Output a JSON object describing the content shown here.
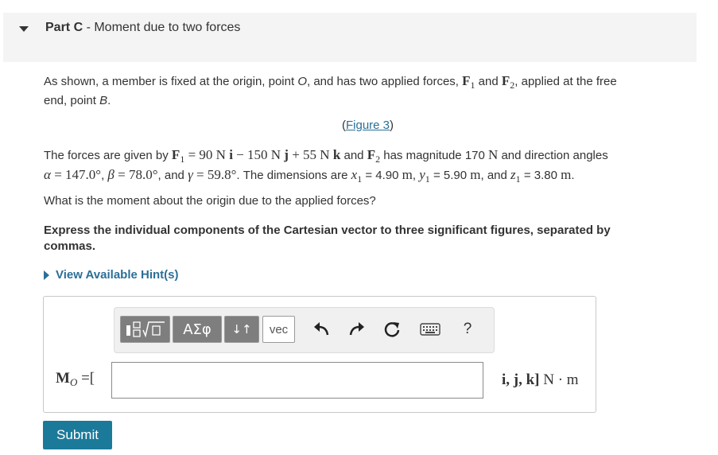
{
  "part": {
    "label": "Part C",
    "separator": " - ",
    "title": "Moment due to two forces"
  },
  "intro": {
    "t1": "As shown, a member is fixed at the origin, point ",
    "point_o": "O",
    "t2": ", and has two applied forces, ",
    "f1_sym": "F",
    "f1_sub": "1",
    "and": " and ",
    "f2_sym": "F",
    "f2_sub": "2",
    "t3": ", applied at the free",
    "line2": "end, point ",
    "point_b": "B",
    "end": "."
  },
  "figure": {
    "open": "(",
    "link": "Figure 3",
    "close": ")"
  },
  "forces": {
    "t1": "The forces are given by ",
    "f1_sym": "F",
    "f1_sub": "1",
    "f1_eq": " = 90 N ",
    "i": "i",
    "m1": " − 150 N ",
    "j": "j",
    "p1": " + 55 N ",
    "k": "k",
    "and": " and ",
    "f2_sym": "F",
    "f2_sub": "2",
    "t2": " has magnitude 170 ",
    "unit_n": "N",
    "t3": " and direction angles",
    "alpha": "α",
    "alpha_val": " = 147.0°",
    "c1": ", ",
    "beta": "β",
    "beta_val": " = 78.0°",
    "c2": ", and ",
    "gamma": "γ",
    "gamma_val": " = 59.8°",
    "t4": ". The dimensions are ",
    "x": "x",
    "x_sub": "1",
    "x_val": " = 4.90 ",
    "unit_m1": "m",
    "c3": ", ",
    "y": "y",
    "y_sub": "1",
    "y_val": " = 5.90 ",
    "unit_m2": "m",
    "c4": ", and ",
    "z": "z",
    "z_sub": "1",
    "z_val": " = 3.80 ",
    "unit_m3": "m",
    "end": "."
  },
  "question": "What is the moment about the origin due to the applied forces?",
  "instruction": {
    "line1": "Express the individual components of the Cartesian vector to three significant figures, separated by",
    "line2": "commas."
  },
  "hint": "View Available Hint(s)",
  "toolbar": {
    "greek": "ΑΣφ",
    "arrows": "↓↑",
    "vec": "vec",
    "help": "?"
  },
  "answer": {
    "label_m": "M",
    "label_sub": "O",
    "label_eq": " =[",
    "value": "",
    "units_vec": "i, j, k]",
    "units": " N · m"
  },
  "submit": "Submit"
}
